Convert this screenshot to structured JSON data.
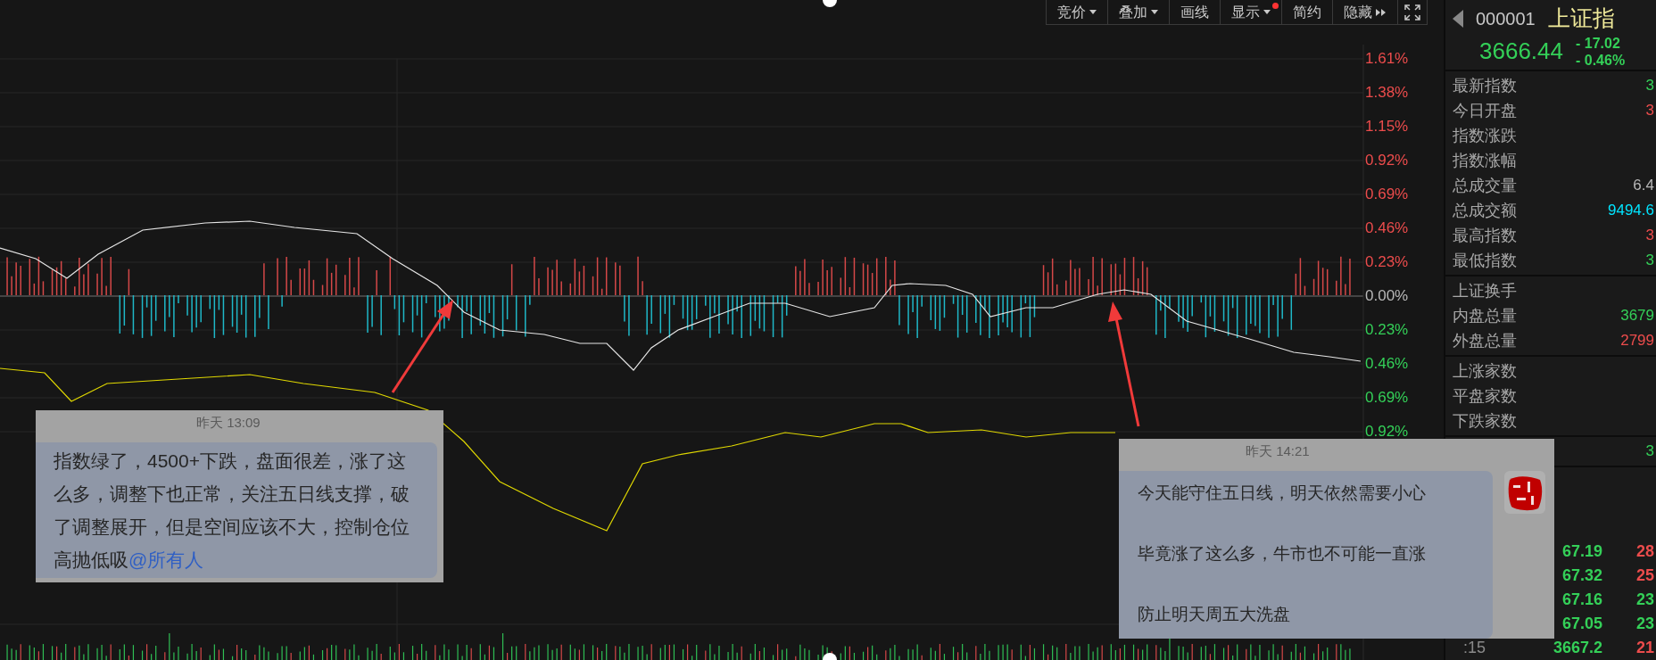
{
  "toolbar": [
    {
      "label": "竞价",
      "kind": "dropdown",
      "alert": false
    },
    {
      "label": "叠加",
      "kind": "dropdown",
      "alert": false
    },
    {
      "label": "画线",
      "kind": "plain",
      "alert": false
    },
    {
      "label": "显示",
      "kind": "dropdown",
      "alert": true
    },
    {
      "label": "简约",
      "kind": "plain",
      "alert": false
    },
    {
      "label": "隐藏",
      "kind": "expand",
      "alert": false
    }
  ],
  "axis_labels": [
    {
      "text": "1.61%",
      "color": "#ec4c4c"
    },
    {
      "text": "1.38%",
      "color": "#ec4c4c"
    },
    {
      "text": "1.15%",
      "color": "#ec4c4c"
    },
    {
      "text": "0.92%",
      "color": "#ec4c4c"
    },
    {
      "text": "0.69%",
      "color": "#ec4c4c"
    },
    {
      "text": "0.46%",
      "color": "#ec4c4c"
    },
    {
      "text": "0.23%",
      "color": "#ec4c4c"
    },
    {
      "text": "0.00%",
      "color": "#b8b8b8"
    },
    {
      "text": "0.23%",
      "color": "#34d058"
    },
    {
      "text": "0.46%",
      "color": "#34d058"
    },
    {
      "text": "0.69%",
      "color": "#34d058"
    },
    {
      "text": "0.92%",
      "color": "#34d058"
    }
  ],
  "quote": {
    "code": "000001",
    "name": "上证指",
    "price": "3666.44",
    "change": "- 17.02",
    "change_pct": "- 0.46%"
  },
  "stats_groups": [
    [
      {
        "label": "最新指数",
        "value": "3",
        "color": "#34d058"
      },
      {
        "label": "今日开盘",
        "value": "3",
        "color": "#ec4c4c"
      },
      {
        "label": "指数涨跌"
      },
      {
        "label": "指数涨幅"
      },
      {
        "label": "总成交量",
        "value": "6.4",
        "color": "#b8b8b8"
      },
      {
        "label": "总成交额",
        "value": "9494.6",
        "color": "#00e4ff"
      },
      {
        "label": "最高指数",
        "value": "3",
        "color": "#ec4c4c"
      },
      {
        "label": "最低指数",
        "value": "3",
        "color": "#34d058"
      }
    ],
    [
      {
        "label": "上证换手"
      },
      {
        "label": "内盘总量",
        "value": "3679",
        "color": "#34d058"
      },
      {
        "label": "外盘总量",
        "value": "2799",
        "color": "#ec4c4c"
      }
    ],
    [
      {
        "label": "上涨家数"
      },
      {
        "label": "平盘家数"
      },
      {
        "label": "下跌家数"
      }
    ],
    [
      {
        "value": "3",
        "color": "#34d058"
      }
    ]
  ],
  "trades": [
    {
      "price": "67.19",
      "volume": "28",
      "color": "#ec4c4c"
    },
    {
      "price": "67.32",
      "volume": "25",
      "color": "#ec4c4c"
    },
    {
      "price": "67.16",
      "volume": "23",
      "color": "#34d058"
    },
    {
      "price": "67.05",
      "volume": "23",
      "color": "#34d058"
    },
    {
      "time": ":15",
      "price": "3667.2",
      "volume": "21",
      "color": "#ec4c4c"
    }
  ],
  "messages": [
    {
      "time": "昨天 13:09",
      "paragraphs": [
        "指数绿了，4500+下跌，盘面很差，涨了这么多，调整下也正常，关注五日线支撑，破了调整展开，但是空间应该不大，控制仓位高抛低吸"
      ],
      "mention": "@所有人",
      "avatar": false
    },
    {
      "time": "昨天 14:21",
      "paragraphs": [
        "今天能守住五日线，明天依然需要小心",
        "毕竟涨了这么多，牛市也不可能一直涨",
        "防止明天周五大洗盘"
      ],
      "avatar": true
    }
  ]
}
